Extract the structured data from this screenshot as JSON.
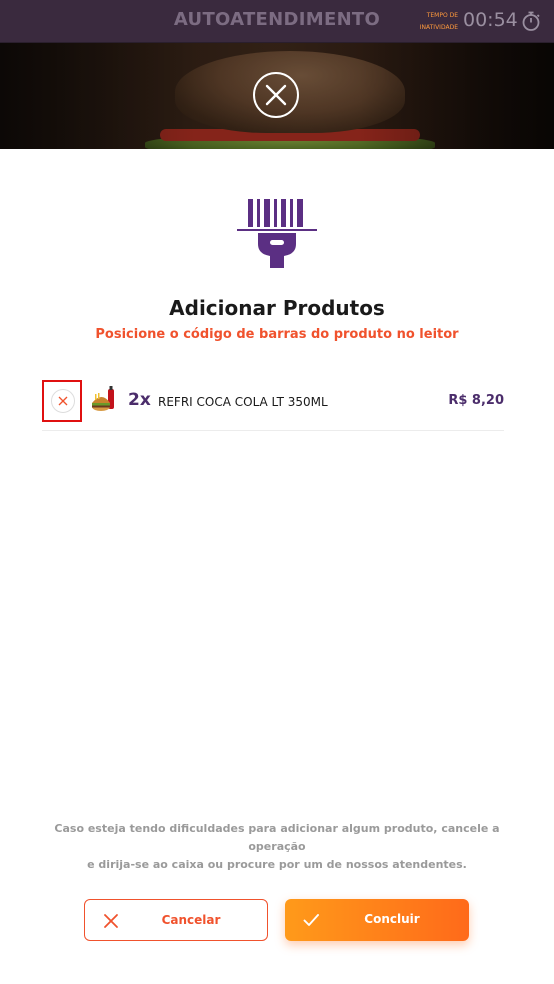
{
  "header": {
    "title": "AUTOATENDIMENTO",
    "inactivity_label_line1": "TEMPO DE",
    "inactivity_label_line2": "INATIVIDADE",
    "timer": "00:54",
    "timer_icon": "stopwatch-icon"
  },
  "banner": {
    "close_icon": "close-icon"
  },
  "main": {
    "scanner_icon": "barcode-scanner-icon",
    "title": "Adicionar Produtos",
    "subtitle": "Posicione o código de barras do produto no leitor"
  },
  "cart": {
    "items": [
      {
        "quantity": "2x",
        "name": "REFRI COCA COLA LT 350ML",
        "price": "R$ 8,20",
        "remove_icon": "remove-icon",
        "thumbnail": "product-thumbnail"
      }
    ]
  },
  "help_text_line1": "Caso esteja tendo dificuldades para adicionar algum produto, cancele a operação",
  "help_text_line2": "e dirija-se ao caixa ou procure por um de nossos atendentes.",
  "actions": {
    "cancel_label": "Cancelar",
    "confirm_label": "Concluir"
  },
  "colors": {
    "brand_purple": "#4b2d6b",
    "accent_orange": "#f0522d",
    "header_bg": "#3a2a3e"
  }
}
